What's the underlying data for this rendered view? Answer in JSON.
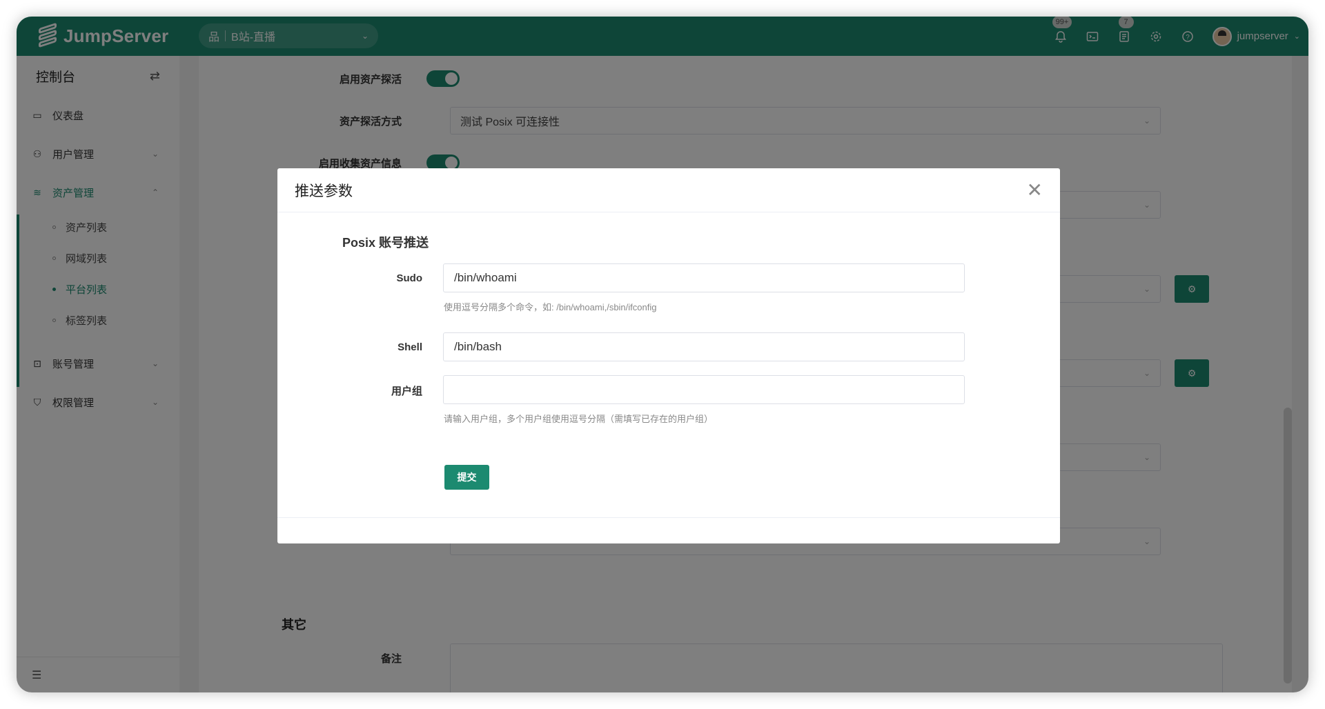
{
  "header": {
    "brand": "JumpServer",
    "org": {
      "icon": "org-icon",
      "name": "B站-直播"
    },
    "icons": [
      {
        "name": "bell-icon",
        "glyph": "🔔",
        "badge": "99+"
      },
      {
        "name": "terminal-icon",
        "glyph": "▣",
        "badge": ""
      },
      {
        "name": "tickets-icon",
        "glyph": "☰",
        "badge": "7"
      },
      {
        "name": "settings-icon",
        "glyph": "⚙",
        "badge": ""
      },
      {
        "name": "help-icon",
        "glyph": "?",
        "badge": ""
      }
    ],
    "user": "jumpserver"
  },
  "sidebar": {
    "title": "控制台",
    "items": [
      {
        "label": "仪表盘"
      },
      {
        "label": "用户管理"
      },
      {
        "label": "资产管理"
      },
      {
        "label": "账号管理"
      },
      {
        "label": "权限管理"
      }
    ],
    "subitems": [
      {
        "label": "资产列表"
      },
      {
        "label": "网域列表"
      },
      {
        "label": "平台列表"
      },
      {
        "label": "标签列表"
      }
    ]
  },
  "background_form": {
    "rows": [
      {
        "label": "启用资产探活"
      },
      {
        "label": "资产探活方式",
        "value": "测试 Posix 可连接性"
      },
      {
        "label": "启用收集资产信息"
      }
    ],
    "other_section": "其它",
    "remark_label": "备注"
  },
  "modal": {
    "title": "推送参数",
    "section": "Posix 账号推送",
    "fields": {
      "sudo": {
        "label": "Sudo",
        "value": "/bin/whoami",
        "help": "使用逗号分隔多个命令，如: /bin/whoami,/sbin/ifconfig"
      },
      "shell": {
        "label": "Shell",
        "value": "/bin/bash"
      },
      "groups": {
        "label": "用户组",
        "value": "",
        "help": "请输入用户组，多个用户组使用逗号分隔（需填写已存在的用户组）"
      }
    },
    "submit": "提交"
  },
  "colors": {
    "brand": "#1c8a70"
  }
}
